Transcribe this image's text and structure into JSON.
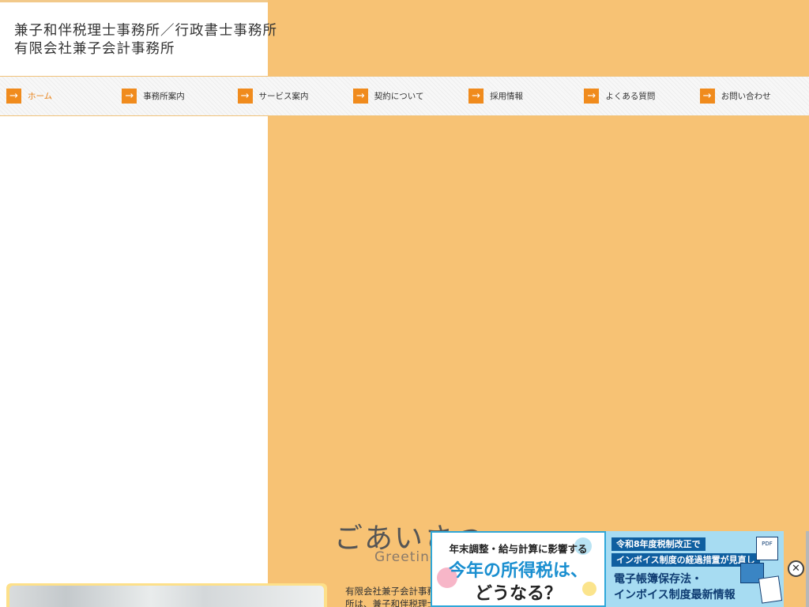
{
  "header": {
    "title_line1": "兼子和伴税理士事務所／行政書士事務所",
    "title_line2": "有限会社兼子会計事務所"
  },
  "nav": {
    "items": [
      {
        "label": "ホーム",
        "active": true
      },
      {
        "label": "事務所案内"
      },
      {
        "label": "サービス案内"
      },
      {
        "label": "契約について"
      },
      {
        "label": "採用情報"
      },
      {
        "label": "よくある質問"
      },
      {
        "label": "お問い合わせ"
      }
    ],
    "arrow_icon": "arrow-right-icon"
  },
  "greeting": {
    "heading": "ごあいさつ",
    "subheading": "Greeting",
    "text": "有限会社兼子会計事務所は、兼子和伴税理士事務所の関連会計事務所です"
  },
  "ads": {
    "ad1": {
      "sub": "年末調整・給与計算に影響する",
      "main1": "今年の所得税は、",
      "main2": "どうなる？"
    },
    "ad2": {
      "bar1": "令和8年度税制改正で",
      "bar2": "インボイス制度の経過措置が見直し",
      "big1": "電子帳簿保存法・",
      "big2": "インボイス制度最新情報",
      "icon_label": "PDF"
    },
    "close_label": "✕"
  },
  "colors": {
    "accent": "#f08b1d",
    "background_orange": "#f7c274",
    "ad_blue": "#1a8fd0"
  }
}
